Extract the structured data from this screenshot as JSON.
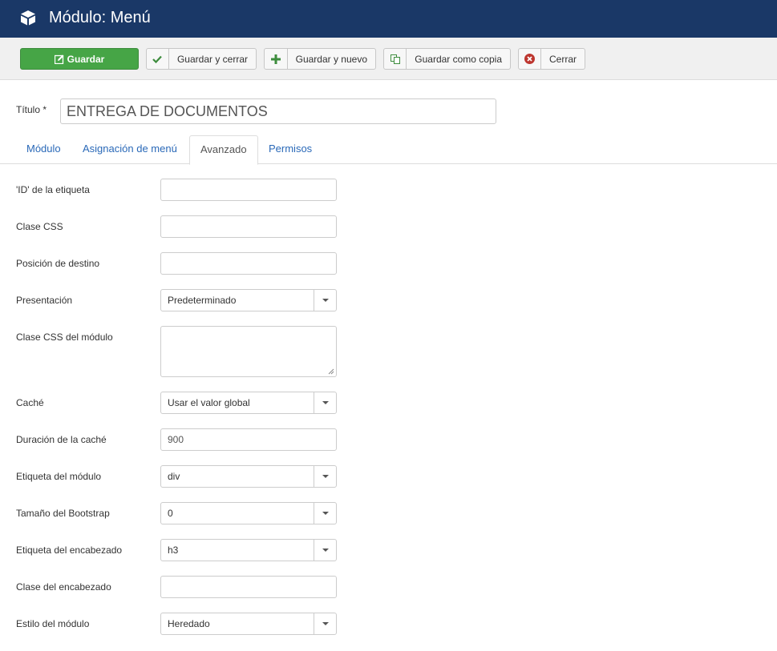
{
  "header": {
    "title": "Módulo: Menú",
    "logo_icon": "joomla-cube-icon"
  },
  "toolbar": {
    "save_label": "Guardar",
    "save_close_label": "Guardar y cerrar",
    "save_new_label": "Guardar y nuevo",
    "save_copy_label": "Guardar como copia",
    "close_label": "Cerrar"
  },
  "form_title": {
    "label": "Título *",
    "value": "ENTREGA DE DOCUMENTOS"
  },
  "tabs": [
    {
      "label": "Módulo"
    },
    {
      "label": "Asignación de menú"
    },
    {
      "label": "Avanzado"
    },
    {
      "label": "Permisos"
    }
  ],
  "fields": {
    "id_label": {
      "label": "'ID' de la etiqueta",
      "value": ""
    },
    "css_class": {
      "label": "Clase CSS",
      "value": ""
    },
    "target_position": {
      "label": "Posición de destino",
      "value": ""
    },
    "layout": {
      "label": "Presentación",
      "value": "Predeterminado"
    },
    "module_css": {
      "label": "Clase CSS del módulo",
      "value": ""
    },
    "cache": {
      "label": "Caché",
      "value": "Usar el valor global"
    },
    "cache_time": {
      "label": "Duración de la caché",
      "value": "900"
    },
    "module_tag": {
      "label": "Etiqueta del módulo",
      "value": "div"
    },
    "bootstrap_size": {
      "label": "Tamaño del Bootstrap",
      "value": "0"
    },
    "header_tag": {
      "label": "Etiqueta del encabezado",
      "value": "h3"
    },
    "header_class": {
      "label": "Clase del encabezado",
      "value": ""
    },
    "module_style": {
      "label": "Estilo del módulo",
      "value": "Heredado"
    }
  },
  "colors": {
    "header_bg": "#1a3867",
    "save_green": "#46a546",
    "link_blue": "#2a69b8"
  }
}
